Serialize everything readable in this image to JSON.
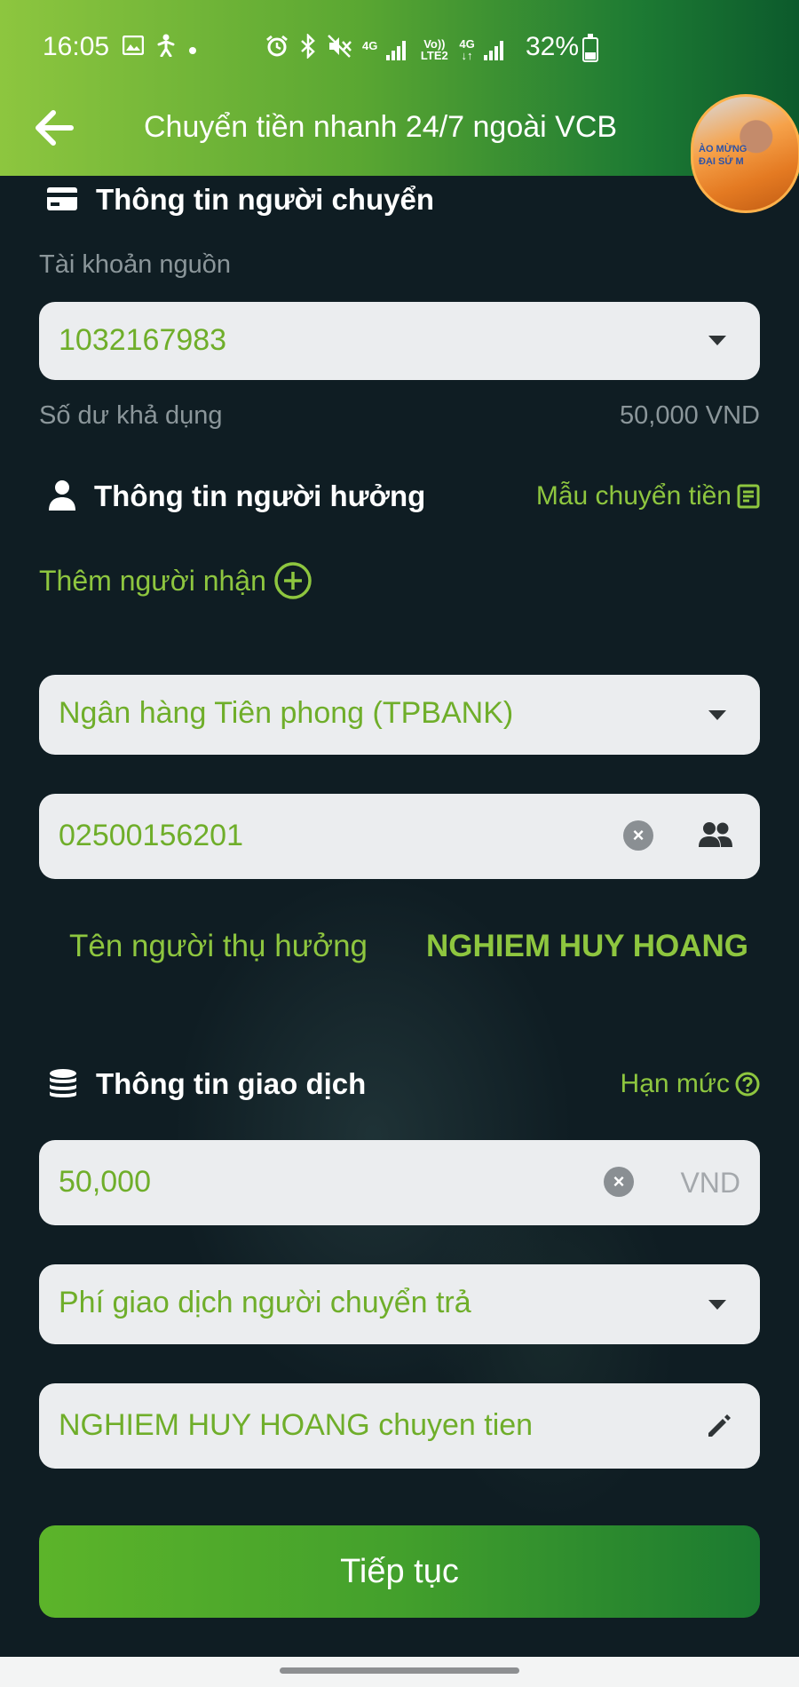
{
  "status_bar": {
    "time": "16:05",
    "network_1": "4G",
    "volte": "Vo))",
    "lte": "LTE2",
    "network_2": "4G",
    "battery": "32%",
    "battery_level": 0.32
  },
  "header": {
    "title": "Chuyển tiền nhanh 24/7 ngoài VCB",
    "avatar_banner": "ÀO MỪNG\nĐẠI SỨ M"
  },
  "sender": {
    "section_title": "Thông tin người chuyển",
    "source_label": "Tài khoản nguồn",
    "source_account": "1032167983",
    "balance_label": "Số dư khả dụng",
    "balance_value": "50,000 VND"
  },
  "beneficiary": {
    "section_title": "Thông tin người hưởng",
    "template_link": "Mẫu chuyển tiền",
    "add_recipient": "Thêm người nhận",
    "bank": "Ngân hàng Tiên phong (TPBANK)",
    "account_number": "02500156201",
    "name_label": "Tên người thụ hưởng",
    "name_value": "NGHIEM HUY HOANG"
  },
  "transaction": {
    "section_title": "Thông tin giao dịch",
    "limit_link": "Hạn mức",
    "amount": "50,000",
    "currency": "VND",
    "fee_option": "Phí giao dịch người chuyển trả",
    "note": "NGHIEM HUY HOANG chuyen tien"
  },
  "actions": {
    "continue": "Tiếp tục"
  },
  "colors": {
    "accent_green": "#8ec63f",
    "field_bg": "#ebedef",
    "page_bg": "#0f1d23"
  }
}
